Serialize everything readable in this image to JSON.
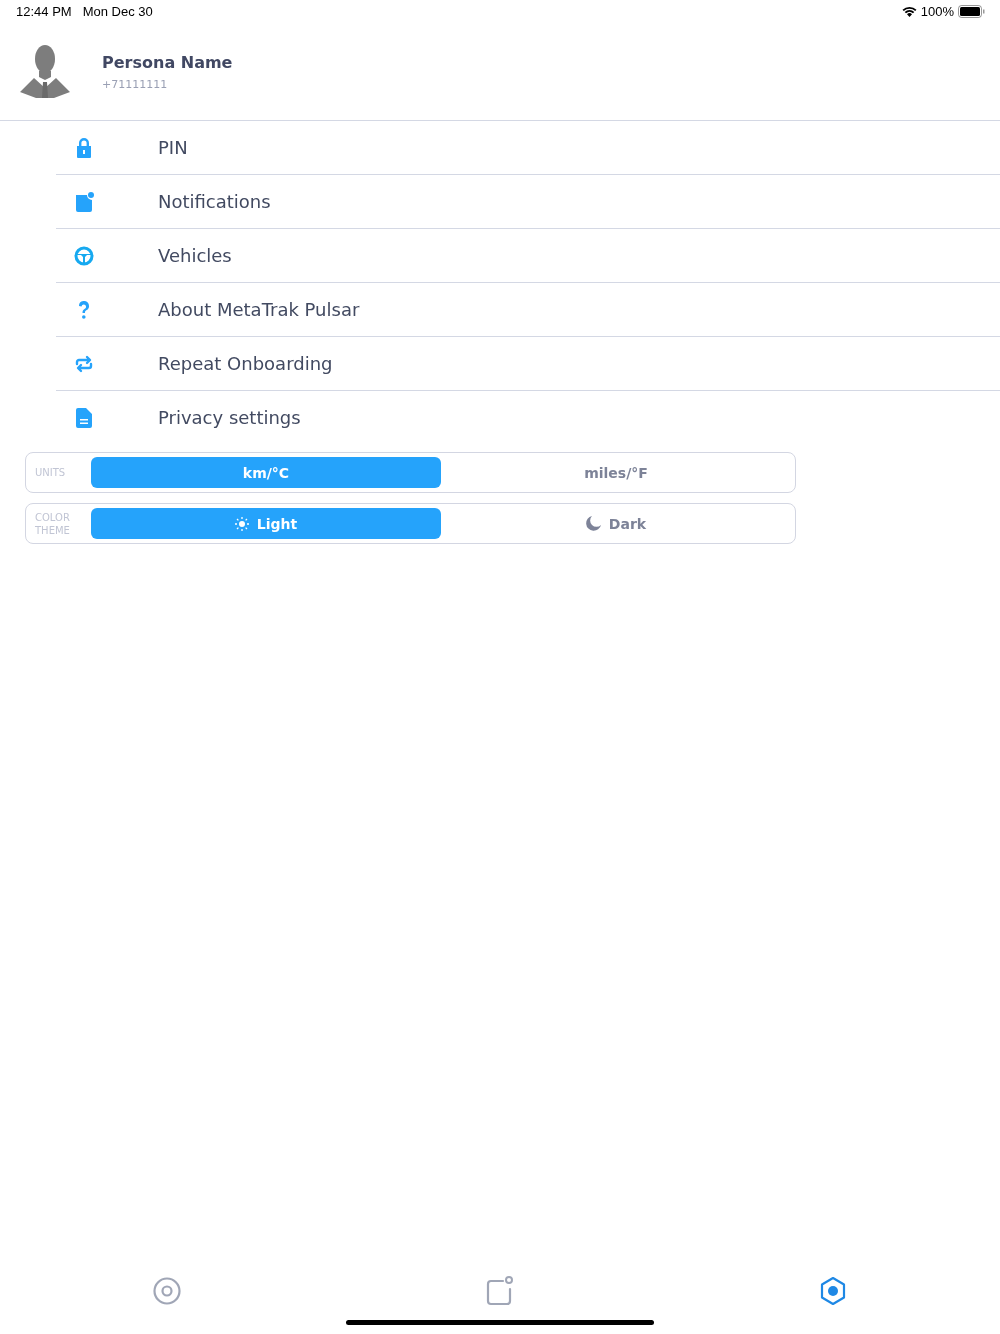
{
  "status_bar": {
    "time": "12:44 PM",
    "date": "Mon Dec 30",
    "battery": "100%"
  },
  "profile": {
    "name": "Persona Name",
    "phone": "+71111111"
  },
  "menu": [
    {
      "kind": "lock",
      "label": "PIN"
    },
    {
      "kind": "notification",
      "label": "Notifications"
    },
    {
      "kind": "wheel",
      "label": "Vehicles"
    },
    {
      "kind": "question",
      "label": "About MetaTrak Pulsar"
    },
    {
      "kind": "repeat",
      "label": "Repeat Onboarding"
    },
    {
      "kind": "document",
      "label": "Privacy settings"
    }
  ],
  "settings": [
    {
      "label": "UNITS",
      "options": [
        {
          "kind": "plain",
          "label": "km/°C",
          "selected": true
        },
        {
          "kind": "plain",
          "label": "miles/°F",
          "selected": false
        }
      ]
    },
    {
      "label": "COLOR THEME",
      "options": [
        {
          "kind": "sun",
          "label": "Light",
          "selected": true
        },
        {
          "kind": "moon",
          "label": "Dark",
          "selected": false
        }
      ]
    }
  ],
  "tab_bar": [
    {
      "kind": "target",
      "selected": false
    },
    {
      "kind": "widget",
      "selected": false
    },
    {
      "kind": "hexagon",
      "selected": true
    }
  ]
}
